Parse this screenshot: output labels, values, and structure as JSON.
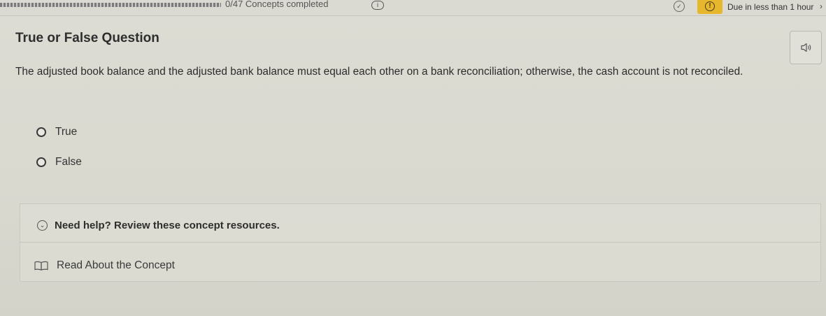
{
  "topbar": {
    "progress_text": "0/47 Concepts completed",
    "info_label": "i",
    "due_text": "Due in less than 1 hour",
    "due_chevron": "›",
    "alert_symbol": "!",
    "check_symbol": "✓"
  },
  "question": {
    "title": "True or False Question",
    "text": "The adjusted book balance and the adjusted bank balance must equal each other on a bank reconciliation; otherwise, the cash account is not reconciled.",
    "options": [
      {
        "label": "True"
      },
      {
        "label": "False"
      }
    ]
  },
  "help": {
    "title": "Need help? Review these concept resources.",
    "link_label": "Read About the Concept",
    "chevron_symbol": "⌄"
  },
  "icons": {
    "speaker": "speaker-icon",
    "book": "book-icon",
    "alert": "alert-icon",
    "check": "check-circle-icon",
    "chevron": "chevron-down-icon"
  },
  "colors": {
    "alert_badge": "#e6b62c",
    "background": "#dcdcd4"
  }
}
